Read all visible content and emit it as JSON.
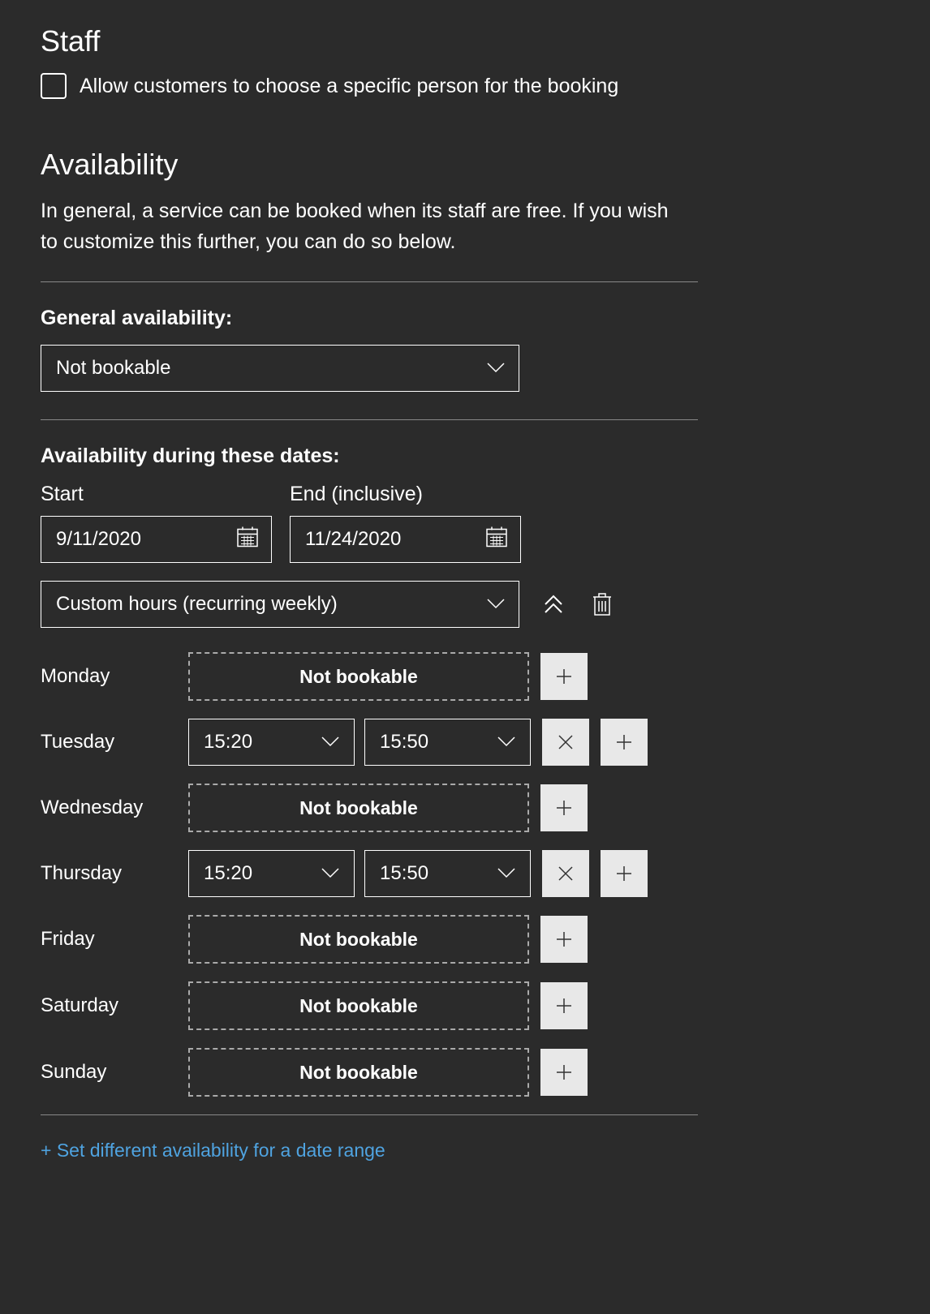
{
  "staff": {
    "heading": "Staff",
    "checkbox_label": "Allow customers to choose a specific person for the booking"
  },
  "availability": {
    "heading": "Availability",
    "description": "In general, a service can be booked when its staff are free. If you wish to customize this further, you can do so below.",
    "general_label": "General availability:",
    "general_value": "Not bookable",
    "dates_label": "Availability during these dates:",
    "start_label": "Start",
    "end_label": "End (inclusive)",
    "start_value": "9/11/2020",
    "end_value": "11/24/2020",
    "hours_value": "Custom hours (recurring weekly)",
    "days": [
      {
        "name": "Monday",
        "type": "notbookable",
        "label": "Not bookable"
      },
      {
        "name": "Tuesday",
        "type": "time",
        "start": "15:20",
        "end": "15:50"
      },
      {
        "name": "Wednesday",
        "type": "notbookable",
        "label": "Not bookable"
      },
      {
        "name": "Thursday",
        "type": "time",
        "start": "15:20",
        "end": "15:50"
      },
      {
        "name": "Friday",
        "type": "notbookable",
        "label": "Not bookable"
      },
      {
        "name": "Saturday",
        "type": "notbookable",
        "label": "Not bookable"
      },
      {
        "name": "Sunday",
        "type": "notbookable",
        "label": "Not bookable"
      }
    ],
    "add_range_link": "+ Set different availability for a date range"
  }
}
